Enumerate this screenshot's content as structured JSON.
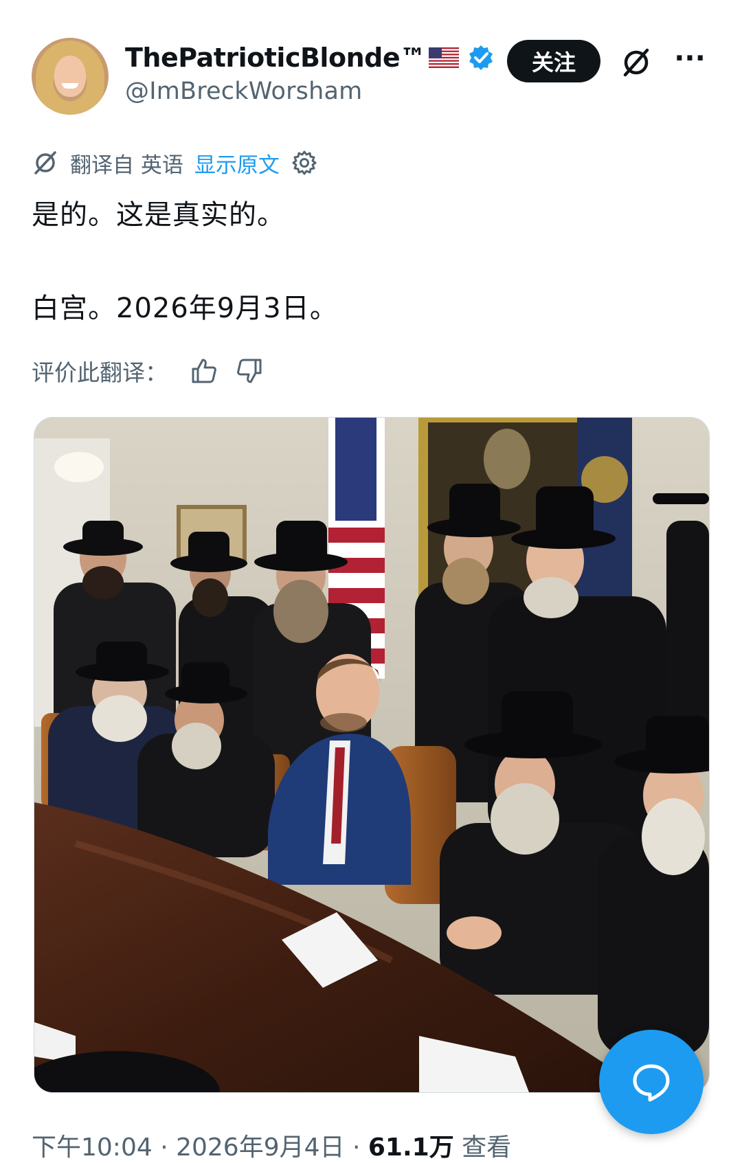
{
  "author": {
    "display_name": "ThePatrioticBlonde™",
    "handle": "@ImBreckWorsham",
    "verified": true
  },
  "header_actions": {
    "follow_label": "关注"
  },
  "translation": {
    "translated_from": "翻译自 英语",
    "show_original": "显示原文"
  },
  "tweet": {
    "line1": "是的。这是真实的。",
    "line2": "白宫。2026年9月3日。"
  },
  "rate_translation": {
    "label": "评价此翻译："
  },
  "meta": {
    "time": "下午10:04",
    "date": "2026年9月4日",
    "views_count": "61.1万",
    "views_label": "查看"
  },
  "colors": {
    "accent": "#1d9bf0",
    "text_primary": "#0f1419",
    "text_secondary": "#536471"
  },
  "icons": {
    "verified": "verified-badge-icon",
    "grok": "grok-icon",
    "more": "more-icon",
    "translate": "translate-icon",
    "settings": "gear-icon",
    "like": "thumbs-up-icon",
    "dislike": "thumbs-down-icon",
    "reply": "chat-bubble-icon"
  }
}
